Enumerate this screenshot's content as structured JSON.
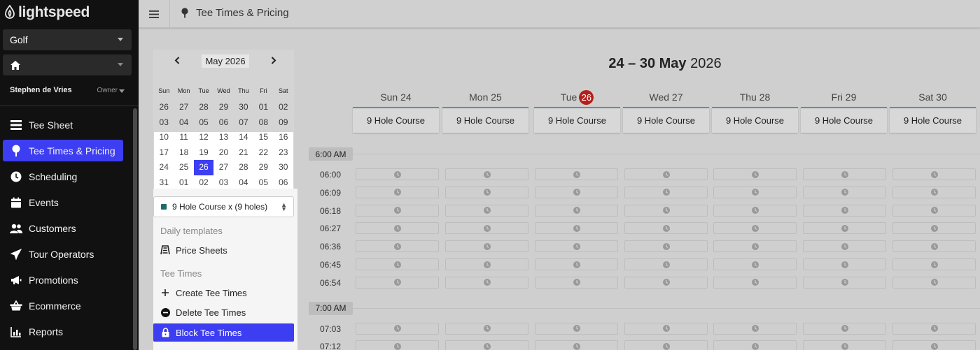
{
  "app": {
    "brand": "lightspeed",
    "brand_color": "#ffffff",
    "accent": "#3d3df2"
  },
  "sidebar": {
    "venue_select": "Golf",
    "location_icon": "home-icon",
    "user_name": "Stephen de Vries",
    "user_role": "Owner",
    "items": [
      {
        "label": "Tee Sheet",
        "icon": "tee-sheet-icon"
      },
      {
        "label": "Tee Times & Pricing",
        "icon": "golf-tee-icon",
        "active": true
      },
      {
        "label": "Scheduling",
        "icon": "clock-icon"
      },
      {
        "label": "Events",
        "icon": "calendar-icon"
      },
      {
        "label": "Customers",
        "icon": "users-icon"
      },
      {
        "label": "Tour Operators",
        "icon": "plane-icon"
      },
      {
        "label": "Promotions",
        "icon": "megaphone-icon"
      },
      {
        "label": "Ecommerce",
        "icon": "basket-icon"
      },
      {
        "label": "Reports",
        "icon": "chart-icon"
      }
    ]
  },
  "topbar": {
    "title": "Tee Times & Pricing"
  },
  "mini_calendar": {
    "month_label": "May 2026",
    "weekdays": [
      "Sun",
      "Mon",
      "Tue",
      "Wed",
      "Thu",
      "Fri",
      "Sat"
    ],
    "weeks": [
      [
        "26",
        "27",
        "28",
        "29",
        "30",
        "01",
        "02"
      ],
      [
        "03",
        "04",
        "05",
        "06",
        "07",
        "08",
        "09"
      ],
      [
        "10",
        "11",
        "12",
        "13",
        "14",
        "15",
        "16"
      ],
      [
        "17",
        "18",
        "19",
        "20",
        "21",
        "22",
        "23"
      ],
      [
        "24",
        "25",
        "26",
        "27",
        "28",
        "29",
        "30"
      ],
      [
        "31",
        "01",
        "02",
        "03",
        "04",
        "05",
        "06"
      ]
    ],
    "selected": "26"
  },
  "left_panel": {
    "course_select": "9 Hole Course x (9 holes)",
    "daily_templates_heading": "Daily templates",
    "price_sheets": "Price Sheets",
    "tee_times_heading": "Tee Times",
    "create": "Create Tee Times",
    "delete": "Delete Tee Times",
    "block": "Block Tee Times"
  },
  "week": {
    "range_bold": "24 – 30 May",
    "year": "2026",
    "days": [
      {
        "label": "Sun 24",
        "course": "9 Hole Course"
      },
      {
        "label": "Mon 25",
        "course": "9 Hole Course"
      },
      {
        "label": "Tue",
        "badge": "26",
        "course": "9 Hole Course"
      },
      {
        "label": "Wed 27",
        "course": "9 Hole Course"
      },
      {
        "label": "Thu 28",
        "course": "9 Hole Course"
      },
      {
        "label": "Fri 29",
        "course": "9 Hole Course"
      },
      {
        "label": "Sat 30",
        "course": "9 Hole Course"
      }
    ],
    "hours": [
      {
        "label": "6:00 AM",
        "slots": [
          "06:00",
          "06:09",
          "06:18",
          "06:27",
          "06:36",
          "06:45",
          "06:54"
        ]
      },
      {
        "label": "7:00 AM",
        "slots": [
          "07:03",
          "07:12"
        ]
      }
    ]
  }
}
